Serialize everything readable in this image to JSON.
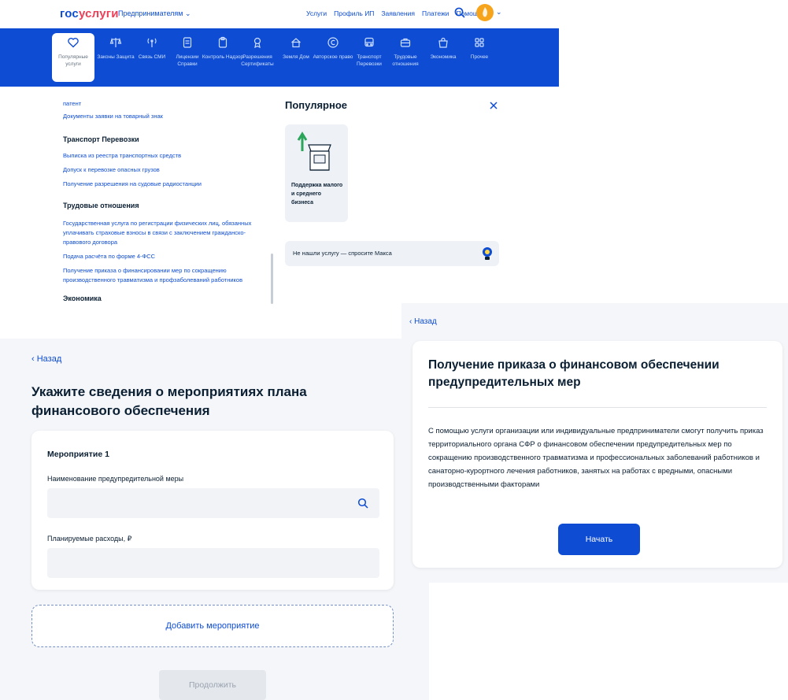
{
  "header": {
    "logo_part1": "гос",
    "logo_part2": "услуги",
    "entity_selector": "Предпринимателям ⌄",
    "nav": [
      "Услуги",
      "Профиль ИП",
      "Заявления",
      "Платежи",
      "Помощь"
    ],
    "avatar_chevron": "⌄"
  },
  "categories": [
    {
      "label": "Популярные услуги",
      "icon": "heart-icon",
      "active": true
    },
    {
      "label": "Законы Защита",
      "icon": "scales-icon"
    },
    {
      "label": "Связь СМИ",
      "icon": "antenna-icon"
    },
    {
      "label": "Лицензии Справки",
      "icon": "document-icon"
    },
    {
      "label": "Контроль Надзор",
      "icon": "clipboard-icon"
    },
    {
      "label": "Разрешения Сертификаты",
      "icon": "certificate-icon"
    },
    {
      "label": "Земля Дом",
      "icon": "house-icon"
    },
    {
      "label": "Авторское право",
      "icon": "copyright-icon"
    },
    {
      "label": "Транспорт Перевозки",
      "icon": "bus-icon"
    },
    {
      "label": "Трудовые отношения",
      "icon": "briefcase-icon"
    },
    {
      "label": "Экономика",
      "icon": "bag-icon"
    },
    {
      "label": "Прочее",
      "icon": "grid-icon"
    }
  ],
  "catalog": {
    "top_links": [
      "патент",
      "Документы заявки на товарный знак"
    ],
    "transport": {
      "title": "Транспорт Перевозки",
      "links": [
        "Выписка из реестра транспортных средств",
        "Допуск к перевозке опасных грузов",
        "Получение разрешения на судовые радиостанции"
      ]
    },
    "labor": {
      "title": "Трудовые отношения",
      "links": [
        "Государственная услуга по регистрации физических лиц, обязанных уплачивать страховые взносы в связи с заключением гражданско-правового договора",
        "Подача расчёта по форме 4-ФСС",
        "Получение приказа о финансировании мер по сокращению производственного травматизма и профзаболеваний работников"
      ]
    },
    "economy_title": "Экономика"
  },
  "popular": {
    "title": "Популярное",
    "card_label": "Поддержка малого и среднего бизнеса",
    "ask_text": "Не нашли услугу — спросите Макса"
  },
  "form": {
    "back": "‹ Назад",
    "title": "Укажите сведения о мероприятиях плана финансового обеспечения",
    "card_title": "Мероприятие 1",
    "field1_label": "Наименование предупредительной меры",
    "field1_value": "",
    "field2_label": "Планируемые расходы, ₽",
    "field2_value": "",
    "add_button": "Добавить мероприятие",
    "continue_button": "Продолжить"
  },
  "service": {
    "back": "‹ Назад",
    "title": "Получение приказа о финансовом обеспечении предупредительных мер",
    "description": "С помощью услуги организации или индивидуальные предприниматели смогут получить приказ территориального органа СФР о финансовом обеспечении предупредительных мер по сокращению производственного травматизма и профессиональных заболеваний работников и санаторно-курортного лечения работников, занятых на работах с вредными, опасными производственными факторами",
    "start_button": "Начать"
  },
  "colors": {
    "brand_blue": "#0d4cd3",
    "brand_red": "#ee3f58",
    "background": "#f4f6f9",
    "text": "#0b1f33"
  }
}
